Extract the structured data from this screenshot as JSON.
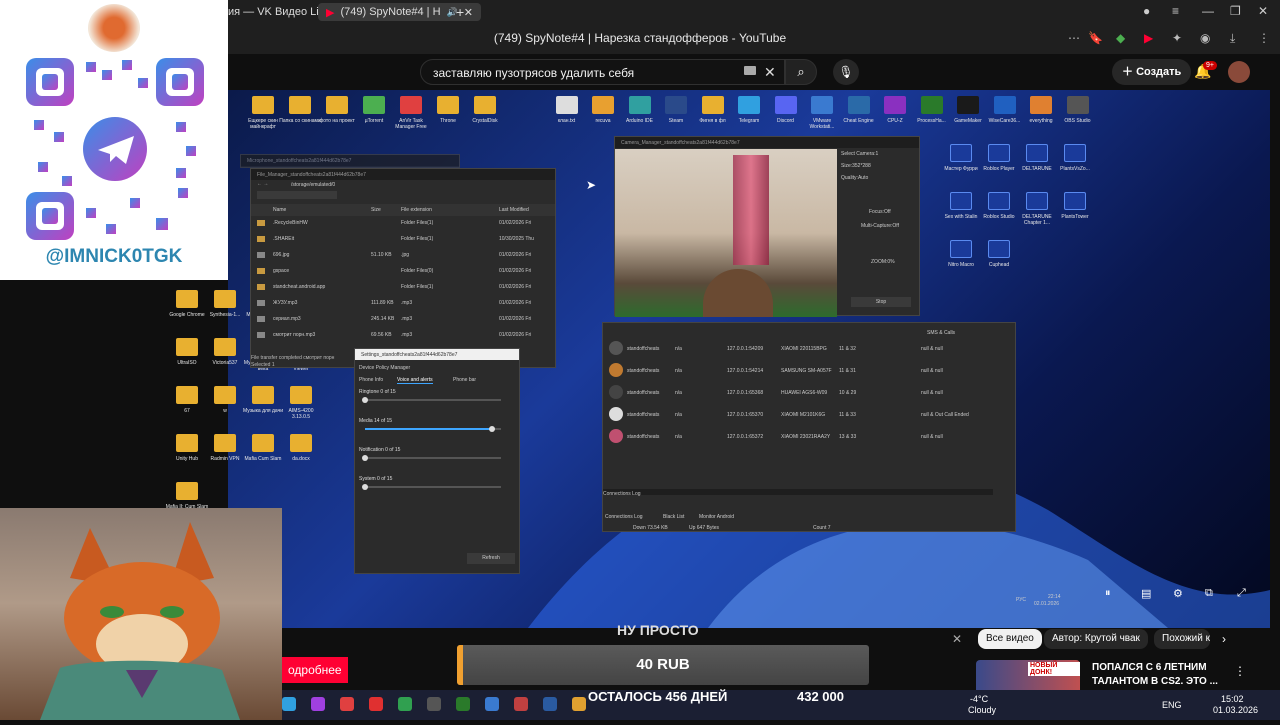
{
  "browser": {
    "tabs": [
      {
        "label": "ия — VK Видео Live"
      },
      {
        "label": "(749) SpyNote#4 | Н"
      }
    ],
    "window_title": "(749) SpyNote#4 | Нарезка стандофферов - YouTube"
  },
  "youtube": {
    "search_value": "заставляю пузотрясов удалить себя",
    "create_label": "Создать",
    "notification_badge": "9+",
    "chips": [
      "Все видео",
      "Автор: Крутой чвак",
      "Похожий к"
    ],
    "rec_title_line1": "ПОПАЛСЯ С 6 ЛЕТНИМ",
    "rec_title_line2": "ТАЛАНТОМ В CS2. ЭТО ...",
    "rec_thumb_badge": "НОВЫЙ ДОНК!",
    "more_label": "одробнее"
  },
  "overlay": {
    "handle": "@IMNICK0TGK",
    "donation_header": "НУ ПРОСТО",
    "donation_amount": "40 RUB",
    "days_left": "ОСТАЛОСЬ 456 ДНЕЙ",
    "total": "432 000"
  },
  "video": {
    "desktop_icons_top": [
      "Ещкере скин майнкрафт",
      "Папка со скинами",
      "фото на проект",
      "µTorrent",
      "AnVir Task Manager Free",
      "Throne",
      "CrystalDisk",
      "клан.txt",
      "recuva",
      "Arduino IDE",
      "Steam",
      "Фигня в фл",
      "Telegram",
      "Discord",
      "VMware Workstati...",
      "Cheat Engine",
      "CPU-Z",
      "ProcessHa...",
      "GameMaker",
      "WiseCare36...",
      "everything",
      "OBS Studio"
    ],
    "desktop_icons_right": [
      "Мастер Фурри",
      "Roblox Player",
      "DELTARUNE",
      "PlantsVsZo...",
      "Sex with Stalin",
      "Roblox Studio",
      "DELTARUNE Chapter 1...",
      "PlantsTower",
      "Nitro Macro",
      "Cuphead"
    ],
    "desktop_icons_left": [
      "Google Chrome",
      "Synthesia-1...",
      "Microsoft Edge",
      "Test",
      "UltraISO",
      "Victoria537",
      "Музыка XX - XXI века",
      "FastStone Image Viewer",
      "67",
      "w",
      "Музыка для дачи",
      "AIMS-4200 3.13.0.5",
      "Unity Hub",
      "Radmin VPN",
      "Mafia Cum Slam",
      "da.docx",
      "Mafia II: Cum Slam 2"
    ],
    "file_manager": {
      "title": "File_Manager_standoffcheats2a81f444d62b78e7",
      "path": "/storage/emulated/0",
      "columns": [
        "Name",
        "Size",
        "File extension",
        "Last Modified"
      ],
      "rows": [
        {
          "name": ".RecycleBinHW",
          "size": "",
          "ext": "Folder Files(1)",
          "date": "01/02/2026 Fri"
        },
        {
          "name": ".SHAREit",
          "size": "",
          "ext": "Folder Files(1)",
          "date": "10/30/2025 Thu"
        },
        {
          "name": "696.jpg",
          "size": "51.10 KB",
          "ext": ".jpg",
          "date": "01/02/2026 Fri"
        },
        {
          "name": "gspace",
          "size": "",
          "ext": "Folder Files(0)",
          "date": "01/02/2026 Fri"
        },
        {
          "name": "standcheat.android.app",
          "size": "",
          "ext": "Folder Files(1)",
          "date": "01/02/2026 Fri"
        },
        {
          "name": "ЖУЗУ.mp3",
          "size": "111.89 KB",
          "ext": ".mp3",
          "date": "01/02/2026 Fri"
        },
        {
          "name": "сериал.mp3",
          "size": "245.14 KB",
          "ext": ".mp3",
          "date": "01/02/2026 Fri"
        },
        {
          "name": "смотрит порн.mp3",
          "size": "69.56 KB",
          "ext": ".mp3",
          "date": "01/02/2026 Fri"
        }
      ],
      "status": "File transfer completed смотрит порн",
      "selected": "Selected 1",
      "ln": "Ln 34"
    },
    "camera": {
      "title": "Camera_Manager_standoffcheats2a81f444d62b78e7",
      "select_camera": "Select Camera:1",
      "size": "Size:352*288",
      "quality": "Quality:Auto",
      "focus": "Focus:Off",
      "multi_capture": "Multi-Capture:Off",
      "zoom": "ZOOM:0%",
      "stop": "Stop"
    },
    "settings": {
      "title": "Settings_standoffcheats2a81f444d62b78e7",
      "header": "Device Policy Manager",
      "tabs": [
        "Phone Info",
        "Voice and alerts",
        "Phone bar"
      ],
      "sliders": [
        {
          "label": "Ringtone 0 of 15",
          "value": 0
        },
        {
          "label": "Media 14 of 15",
          "value": 14
        },
        {
          "label": "Notification 0 of 15",
          "value": 0
        },
        {
          "label": "System 0 of 15",
          "value": 0
        }
      ],
      "max": 15,
      "refresh": "Refresh"
    },
    "clients": {
      "col_sms": "SMS & Calls",
      "rows": [
        {
          "name": "standoffcheats",
          "na": "n/a",
          "ip": "127.0.0.1:54209",
          "device": "XIAOMI 220115BPG",
          "ver": "11 & 32",
          "sms": "null & null"
        },
        {
          "name": "standoffcheats",
          "na": "n/a",
          "ip": "127.0.0.1:54214",
          "device": "SAMSUNG SM-A057F",
          "ver": "11 & 31",
          "sms": "null & null"
        },
        {
          "name": "standoffcheats",
          "na": "n/a",
          "ip": "127.0.0.1:65368",
          "device": "HUAWEI AGS6-W09",
          "ver": "10 & 29",
          "sms": "null & null"
        },
        {
          "name": "standoffcheats",
          "na": "n/a",
          "ip": "127.0.0.1:65370",
          "device": "XIAOMI M2101K6G",
          "ver": "11 & 33",
          "sms": "null & Out Call Ended"
        },
        {
          "name": "standoffcheats",
          "na": "n/a",
          "ip": "127.0.0.1:65372",
          "device": "XIAOMI 23021RAA2Y",
          "ver": "13 & 33",
          "sms": "null & null"
        }
      ],
      "log_title": "Connections Log",
      "log_tabs": [
        "Connections Log",
        "Black List",
        "Monitor Android"
      ],
      "down": "Down 73.54 KB",
      "up": "Up 647 Bytes",
      "count": "Count 7"
    },
    "taskbar": {
      "lang": "РУС",
      "time": "22:14",
      "date": "02.01.2026"
    }
  },
  "host_taskbar": {
    "weather_temp": "-4°C",
    "weather_text": "Cloudy",
    "lang": "ENG",
    "time": "15:02",
    "date": "01.03.2026"
  },
  "colors": {
    "yt_red": "#ff0033",
    "accent": "#3ea6ff",
    "qr_gradient_start": "#3a8ee8",
    "qr_gradient_end": "#c040c0"
  }
}
